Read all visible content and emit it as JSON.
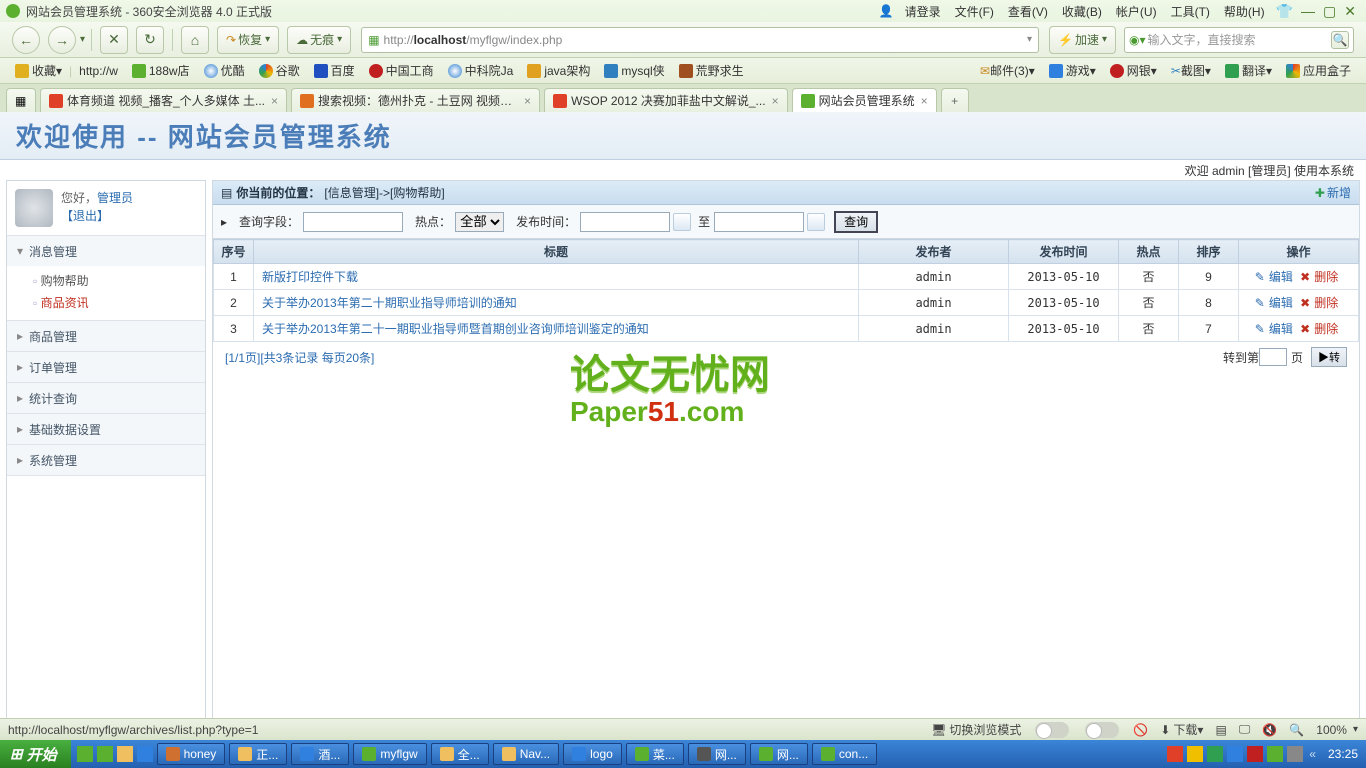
{
  "browser": {
    "title": "网站会员管理系统 - 360安全浏览器 4.0 正式版",
    "login_prompt": "请登录",
    "menus": {
      "file": "文件(F)",
      "view": "查看(V)",
      "fav": "收藏(B)",
      "acct": "帐户(U)",
      "tool": "工具(T)",
      "help": "帮助(H)"
    },
    "nav": {
      "back": "←",
      "fwd": "→",
      "stop": "✕",
      "reload": "↻",
      "home": "⌂",
      "restore": "恢复",
      "notrace": "无痕"
    },
    "url_prefix": "http://",
    "url_host": "localhost",
    "url_path": "/myflgw/index.php",
    "accel": "加速",
    "search_placeholder": "输入文字，直接搜索",
    "bookmarks": {
      "fav": "收藏",
      "http": "http://w",
      "store": "188w店",
      "youku": "优酷",
      "google": "谷歌",
      "baidu": "百度",
      "icbc": "中国工商",
      "cas": "中科院Ja",
      "java": "java架构",
      "mysql": "mysql侠",
      "wild": "荒野求生",
      "mail": "邮件(3)",
      "game": "游戏",
      "bank": "网银",
      "shot": "截图",
      "trans": "翻译",
      "appbox": "应用盒子"
    },
    "tabs": [
      {
        "label": "体育频道 视频_播客_个人多媒体 土..."
      },
      {
        "label": "搜索视频：德州扑克 - 土豆网 视频搜..."
      },
      {
        "label": "WSOP 2012 决赛加菲盐中文解说_..."
      },
      {
        "label": "网站会员管理系统"
      }
    ]
  },
  "app": {
    "header": "欢迎使用 -- 网站会员管理系统",
    "welcome_line": "欢迎 admin [管理员] 使用本系统"
  },
  "sidebar": {
    "greeting_prefix": "您好，",
    "greeting_role": "管理员",
    "logout": "【退出】",
    "groups": [
      {
        "label": "消息管理",
        "open": true,
        "subs": [
          {
            "label": "购物帮助",
            "active": false
          },
          {
            "label": "商品资讯",
            "active": true
          }
        ]
      },
      {
        "label": "商品管理",
        "open": false
      },
      {
        "label": "订单管理",
        "open": false
      },
      {
        "label": "统计查询",
        "open": false
      },
      {
        "label": "基础数据设置",
        "open": false
      },
      {
        "label": "系统管理",
        "open": false
      }
    ]
  },
  "main": {
    "crumb_prefix": "你当前的位置：",
    "crumb_path": "[信息管理]->[购物帮助]",
    "new_btn": "新增",
    "filter": {
      "kw_label": "查询字段：",
      "hot_label": "热点：",
      "hot_value": "全部",
      "time_label": "发布时间：",
      "to_label": "至",
      "search_btn": "查询"
    },
    "columns": {
      "seq": "序号",
      "title": "标题",
      "pub": "发布者",
      "time": "发布时间",
      "hot": "热点",
      "order": "排序",
      "ops": "操作"
    },
    "rows": [
      {
        "seq": "1",
        "title": "新版打印控件下载",
        "pub": "admin",
        "time": "2013-05-10",
        "hot": "否",
        "order": "9"
      },
      {
        "seq": "2",
        "title": "关于举办2013年第二十期职业指导师培训的通知",
        "pub": "admin",
        "time": "2013-05-10",
        "hot": "否",
        "order": "8"
      },
      {
        "seq": "3",
        "title": "关于举办2013年第二十一期职业指导师暨首期创业咨询师培训鉴定的通知",
        "pub": "admin",
        "time": "2013-05-10",
        "hot": "否",
        "order": "7"
      }
    ],
    "ops": {
      "edit": "编辑",
      "del": "删除"
    },
    "pager": {
      "info": "[1/1页][共3条记录 每页20条]",
      "jump": "转到第",
      "page_unit": "页",
      "go": "▶转"
    }
  },
  "watermark": {
    "cn": "论文无忧网",
    "en_pre": "Paper",
    "en_red": "51",
    "en_suf": ".com"
  },
  "statusbar": {
    "url": "http://localhost/myflgw/archives/list.php?type=1",
    "mode": "切换浏览模式",
    "download": "下载",
    "zoom": "100%"
  },
  "taskbar": {
    "start": "开始",
    "items": [
      "honey",
      "正...",
      "酒...",
      "myflgw",
      "全...",
      "Nav...",
      "logo",
      "菜...",
      "网...",
      "网...",
      "con..."
    ],
    "clock": "23:25"
  }
}
